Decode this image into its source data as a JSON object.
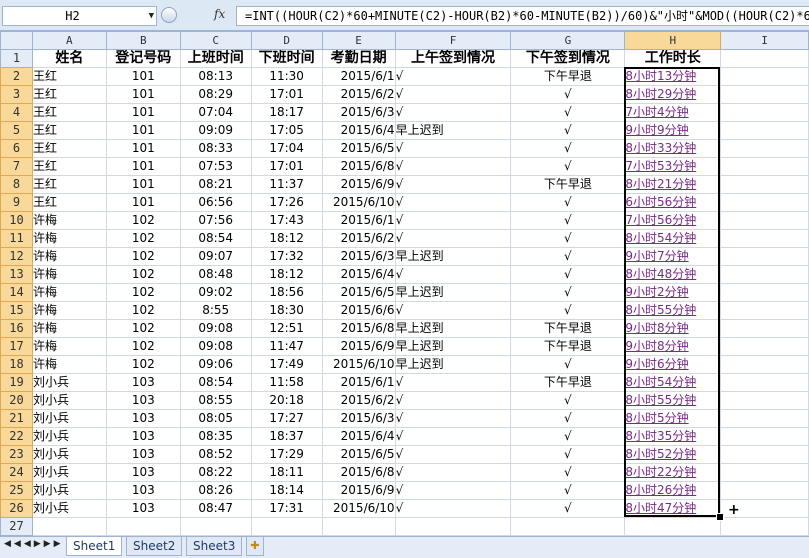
{
  "formula_bar": {
    "name_box": "H2",
    "fx_label": "fx",
    "formula": "=INT((HOUR(C2)*60+MINUTE(C2)-HOUR(B2)*60-MINUTE(B2))/60)&\"小时\"&MOD((HOUR(C2)*60"
  },
  "columns": [
    "A",
    "B",
    "C",
    "D",
    "E",
    "F",
    "G",
    "H",
    "I"
  ],
  "selected_column": "H",
  "headers": [
    "姓名",
    "登记号码",
    "上班时间",
    "下班时间",
    "考勤日期",
    "上午签到情况",
    "下午签到情况",
    "工作时长",
    ""
  ],
  "rows": [
    {
      "num": "2",
      "name": "王红",
      "id": "101",
      "in": "08:13",
      "out": "11:30",
      "date": "2015/6/1",
      "am": "√",
      "pm": "下午早退",
      "dur": "8小时13分钟"
    },
    {
      "num": "3",
      "name": "王红",
      "id": "101",
      "in": "08:29",
      "out": "17:01",
      "date": "2015/6/2",
      "am": "√",
      "pm": "√",
      "dur": "8小时29分钟"
    },
    {
      "num": "4",
      "name": "王红",
      "id": "101",
      "in": "07:04",
      "out": "18:17",
      "date": "2015/6/3",
      "am": "√",
      "pm": "√",
      "dur": "7小时4分钟"
    },
    {
      "num": "5",
      "name": "王红",
      "id": "101",
      "in": "09:09",
      "out": "17:05",
      "date": "2015/6/4",
      "am": "早上迟到",
      "pm": "√",
      "dur": "9小时9分钟"
    },
    {
      "num": "6",
      "name": "王红",
      "id": "101",
      "in": "08:33",
      "out": "17:04",
      "date": "2015/6/5",
      "am": "√",
      "pm": "√",
      "dur": "8小时33分钟"
    },
    {
      "num": "7",
      "name": "王红",
      "id": "101",
      "in": "07:53",
      "out": "17:01",
      "date": "2015/6/8",
      "am": "√",
      "pm": "√",
      "dur": "7小时53分钟"
    },
    {
      "num": "8",
      "name": "王红",
      "id": "101",
      "in": "08:21",
      "out": "11:37",
      "date": "2015/6/9",
      "am": "√",
      "pm": "下午早退",
      "dur": "8小时21分钟"
    },
    {
      "num": "9",
      "name": "王红",
      "id": "101",
      "in": "06:56",
      "out": "17:26",
      "date": "2015/6/10",
      "am": "√",
      "pm": "√",
      "dur": "6小时56分钟"
    },
    {
      "num": "10",
      "name": "许梅",
      "id": "102",
      "in": "07:56",
      "out": "17:43",
      "date": "2015/6/1",
      "am": "√",
      "pm": "√",
      "dur": "7小时56分钟"
    },
    {
      "num": "11",
      "name": "许梅",
      "id": "102",
      "in": "08:54",
      "out": "18:12",
      "date": "2015/6/2",
      "am": "√",
      "pm": "√",
      "dur": "8小时54分钟"
    },
    {
      "num": "12",
      "name": "许梅",
      "id": "102",
      "in": "09:07",
      "out": "17:32",
      "date": "2015/6/3",
      "am": "早上迟到",
      "pm": "√",
      "dur": "9小时7分钟"
    },
    {
      "num": "13",
      "name": "许梅",
      "id": "102",
      "in": "08:48",
      "out": "18:12",
      "date": "2015/6/4",
      "am": "√",
      "pm": "√",
      "dur": "8小时48分钟"
    },
    {
      "num": "14",
      "name": "许梅",
      "id": "102",
      "in": "09:02",
      "out": "18:56",
      "date": "2015/6/5",
      "am": "早上迟到",
      "pm": "√",
      "dur": "9小时2分钟"
    },
    {
      "num": "15",
      "name": "许梅",
      "id": "102",
      "in": "8:55",
      "out": "18:30",
      "date": "2015/6/6",
      "am": "√",
      "pm": "√",
      "dur": "8小时55分钟"
    },
    {
      "num": "16",
      "name": "许梅",
      "id": "102",
      "in": "09:08",
      "out": "12:51",
      "date": "2015/6/8",
      "am": "早上迟到",
      "pm": "下午早退",
      "dur": "9小时8分钟"
    },
    {
      "num": "17",
      "name": "许梅",
      "id": "102",
      "in": "09:08",
      "out": "11:47",
      "date": "2015/6/9",
      "am": "早上迟到",
      "pm": "下午早退",
      "dur": "9小时8分钟"
    },
    {
      "num": "18",
      "name": "许梅",
      "id": "102",
      "in": "09:06",
      "out": "17:49",
      "date": "2015/6/10",
      "am": "早上迟到",
      "pm": "√",
      "dur": "9小时6分钟"
    },
    {
      "num": "19",
      "name": "刘小兵",
      "id": "103",
      "in": "08:54",
      "out": "11:58",
      "date": "2015/6/1",
      "am": "√",
      "pm": "下午早退",
      "dur": "8小时54分钟"
    },
    {
      "num": "20",
      "name": "刘小兵",
      "id": "103",
      "in": "08:55",
      "out": "20:18",
      "date": "2015/6/2",
      "am": "√",
      "pm": "√",
      "dur": "8小时55分钟"
    },
    {
      "num": "21",
      "name": "刘小兵",
      "id": "103",
      "in": "08:05",
      "out": "17:27",
      "date": "2015/6/3",
      "am": "√",
      "pm": "√",
      "dur": "8小时5分钟"
    },
    {
      "num": "22",
      "name": "刘小兵",
      "id": "103",
      "in": "08:35",
      "out": "18:37",
      "date": "2015/6/4",
      "am": "√",
      "pm": "√",
      "dur": "8小时35分钟"
    },
    {
      "num": "23",
      "name": "刘小兵",
      "id": "103",
      "in": "08:52",
      "out": "17:29",
      "date": "2015/6/5",
      "am": "√",
      "pm": "√",
      "dur": "8小时52分钟"
    },
    {
      "num": "24",
      "name": "刘小兵",
      "id": "103",
      "in": "08:22",
      "out": "18:11",
      "date": "2015/6/8",
      "am": "√",
      "pm": "√",
      "dur": "8小时22分钟"
    },
    {
      "num": "25",
      "name": "刘小兵",
      "id": "103",
      "in": "08:26",
      "out": "18:14",
      "date": "2015/6/9",
      "am": "√",
      "pm": "√",
      "dur": "8小时26分钟"
    },
    {
      "num": "26",
      "name": "刘小兵",
      "id": "103",
      "in": "08:47",
      "out": "17:31",
      "date": "2015/6/10",
      "am": "√",
      "pm": "√",
      "dur": "8小时47分钟"
    }
  ],
  "row27": "27",
  "sheet_tabs": [
    "Sheet1",
    "Sheet2",
    "Sheet3"
  ],
  "active_sheet": "Sheet1",
  "colors": {
    "header_bg": "#e4ecf7",
    "selected_header": "#f9d99a",
    "link_text": "#7a2a8a"
  },
  "icons": {
    "new_sheet": "insert-sheet-icon",
    "nav": "sheet-nav-arrows-icon",
    "fx": "function-icon"
  }
}
